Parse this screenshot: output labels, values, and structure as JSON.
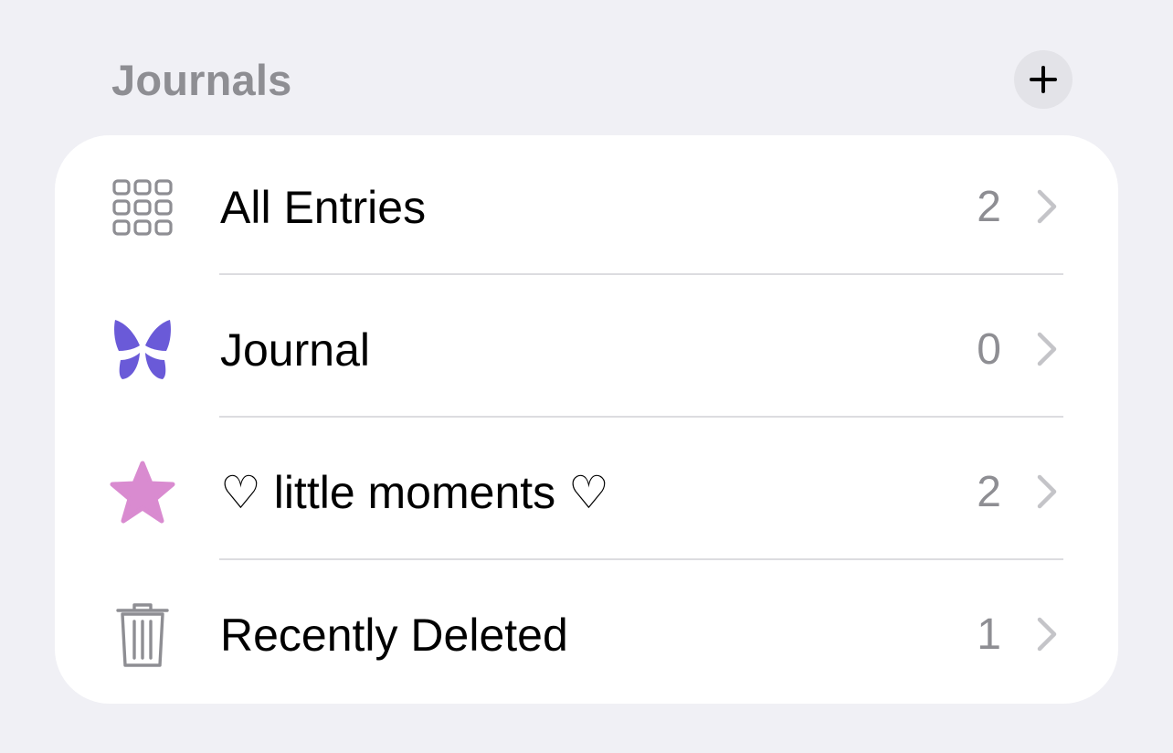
{
  "header": {
    "title": "Journals",
    "add_icon": "plus-icon"
  },
  "journals": [
    {
      "label": "All Entries",
      "count": "2",
      "icon": "grid-icon",
      "icon_color": "#8e8e93"
    },
    {
      "label": "Journal",
      "count": "0",
      "icon": "butterfly-icon",
      "icon_color": "#6a5ad8"
    },
    {
      "label": "♡ little moments ♡",
      "count": "2",
      "icon": "star-icon",
      "icon_color": "#d98bd0"
    },
    {
      "label": "Recently Deleted",
      "count": "1",
      "icon": "trash-icon",
      "icon_color": "#8e8e93"
    }
  ],
  "colors": {
    "background": "#f0f0f5",
    "card": "#ffffff",
    "secondary_text": "#8e8e93",
    "chevron": "#c4c4c8"
  }
}
